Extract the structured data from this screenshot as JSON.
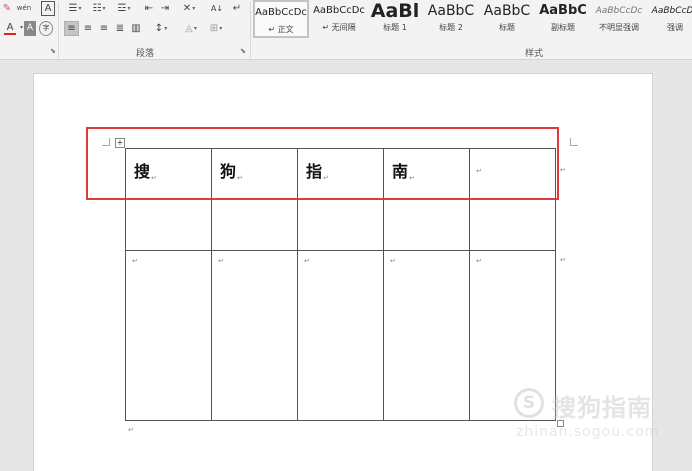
{
  "ribbon": {
    "font_group": {
      "phonetic_icon_text": "wén",
      "border_char": "A",
      "font_color_letter": "A",
      "highlight_letter": "A",
      "enclose_char": "字"
    },
    "paragraph_group": {
      "label": "段落",
      "sort_text": "A↓"
    },
    "styles_group": {
      "label": "样式",
      "tiles": [
        {
          "sample": "AaBbCcDc",
          "name": "↵ 正文",
          "selected": true
        },
        {
          "sample": "AaBbCcDc",
          "name": "↵ 无间隔",
          "selected": false
        },
        {
          "sample": "AaBl",
          "name": "标题 1",
          "selected": false
        },
        {
          "sample": "AaBbC",
          "name": "标题 2",
          "selected": false
        },
        {
          "sample": "AaBbC",
          "name": "标题",
          "selected": false
        },
        {
          "sample": "AaBbC",
          "name": "副标题",
          "selected": false
        },
        {
          "sample": "AaBbCcDc",
          "name": "不明显强调",
          "selected": false
        },
        {
          "sample": "AaBbCcDc",
          "name": "强调",
          "selected": false
        }
      ]
    },
    "colors": {
      "font_color": "#e02020",
      "accent": "#2b579a"
    }
  },
  "document": {
    "table": {
      "rows": [
        {
          "cells": [
            "搜",
            "狗",
            "指",
            "南",
            ""
          ]
        },
        {
          "cells": [
            "",
            "",
            "",
            "",
            ""
          ]
        },
        {
          "cells": [
            "",
            "",
            "",
            "",
            ""
          ]
        }
      ],
      "para_mark": "↵"
    },
    "highlight_color": "#e03a3a"
  },
  "watermark": {
    "logo_char": "S",
    "title": "搜狗指南",
    "url": "zhinan.sogou.com"
  }
}
